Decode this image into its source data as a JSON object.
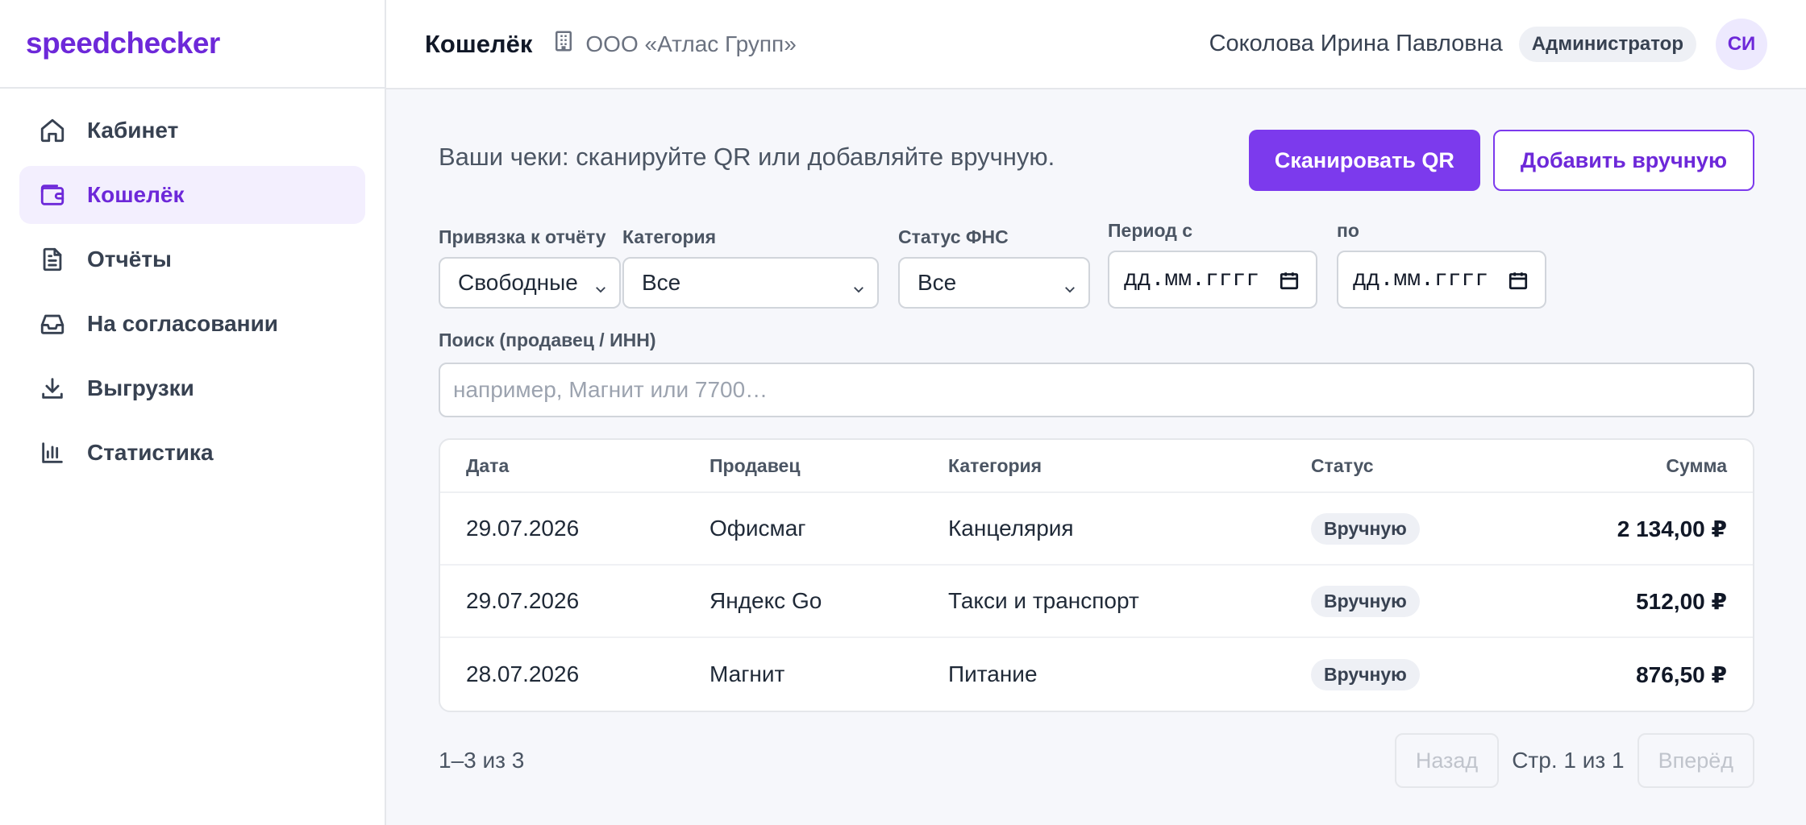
{
  "brand": "speedchecker",
  "sidebar": {
    "items": [
      {
        "label": "Кабинет",
        "icon": "home-icon"
      },
      {
        "label": "Кошелёк",
        "icon": "wallet-icon",
        "active": true
      },
      {
        "label": "Отчёты",
        "icon": "document-icon"
      },
      {
        "label": "На согласовании",
        "icon": "inbox-icon"
      },
      {
        "label": "Выгрузки",
        "icon": "download-icon"
      },
      {
        "label": "Статистика",
        "icon": "chart-icon"
      }
    ]
  },
  "header": {
    "title": "Кошелёк",
    "org": "ООО «Атлас Групп»",
    "user_name": "Соколова Ирина Павловна",
    "role": "Администратор",
    "avatar_initials": "СИ"
  },
  "main": {
    "intro": "Ваши чеки: сканируйте QR или добавляйте вручную.",
    "scan_button": "Сканировать QR",
    "add_button": "Добавить вручную"
  },
  "filters": {
    "report": {
      "label": "Привязка к отчёту",
      "value": "Свободные"
    },
    "category": {
      "label": "Категория",
      "value": "Все"
    },
    "fns_status": {
      "label": "Статус ФНС",
      "value": "Все"
    },
    "period_from": {
      "label": "Период с",
      "value": "дд.мм.гггг"
    },
    "period_to": {
      "label": "по",
      "value": "дд.мм.гггг"
    }
  },
  "search": {
    "label": "Поиск (продавец / ИНН)",
    "placeholder": "например, Магнит или 7700…"
  },
  "table": {
    "headers": {
      "date": "Дата",
      "seller": "Продавец",
      "category": "Категория",
      "status": "Статус",
      "sum": "Сумма"
    },
    "rows": [
      {
        "date": "29.07.2026",
        "seller": "Офисмаг",
        "category": "Канцелярия",
        "status": "Вручную",
        "sum": "2 134,00 ₽"
      },
      {
        "date": "29.07.2026",
        "seller": "Яндекс Go",
        "category": "Такси и транспорт",
        "status": "Вручную",
        "sum": "512,00 ₽"
      },
      {
        "date": "28.07.2026",
        "seller": "Магнит",
        "category": "Питание",
        "status": "Вручную",
        "sum": "876,50 ₽"
      }
    ]
  },
  "pager": {
    "count": "1–3 из 3",
    "prev": "Назад",
    "page_info": "Стр. 1 из 1",
    "next": "Вперёд"
  },
  "colors": {
    "accent": "#7c3aed",
    "accent_text": "#6d28d9",
    "active_bg": "#f3effe",
    "page_bg": "#f6f7fb"
  }
}
